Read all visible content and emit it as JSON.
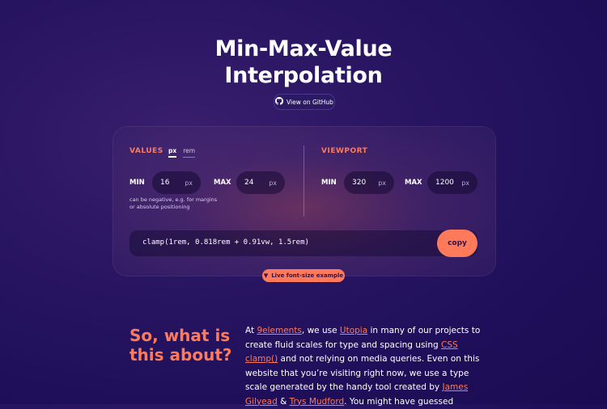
{
  "header": {
    "title_line1": "Min-Max-Value",
    "title_line2": "Interpolation",
    "github_label": "View on GitHub",
    "github_icon": "github-icon"
  },
  "values": {
    "label": "VALUES",
    "unit_px": "px",
    "unit_rem": "rem",
    "min_label": "MIN",
    "min_value": "16",
    "min_unit": "px",
    "max_label": "MAX",
    "max_value": "24",
    "max_unit": "px",
    "hint": "can be negative, e.g. for margins or absolute positioning"
  },
  "viewport": {
    "label": "VIEWPORT",
    "min_label": "MIN",
    "min_value": "320",
    "min_unit": "px",
    "max_label": "MAX",
    "max_value": "1200",
    "max_unit": "px"
  },
  "output": {
    "code": "clamp(1rem, 0.818rem + 0.91vw, 1.5rem)",
    "copy_label": "copy"
  },
  "live_example": {
    "label": "Live font-size example",
    "icon": "triangle-down-icon"
  },
  "about": {
    "heading_line1": "So, what is",
    "heading_line2": "this about?",
    "p1": "At ",
    "link_9elements": "9elements",
    "p2": ", we use ",
    "link_utopia": "Utopia",
    "p3": " in many of our projects to create fluid scales for type and spacing using ",
    "link_clamp": "CSS clamp()",
    "p4": " and not relying on media queries. Even on this website that you’re visiting right now, we use a type scale generated by the handy tool created by ",
    "link_james": "James Gilyead",
    "p5": " & ",
    "link_trys": "Trys Mudford",
    "p6": ". You might have guessed"
  },
  "colors": {
    "accent": "#ff7a5a",
    "background": "#1f0f5a"
  }
}
